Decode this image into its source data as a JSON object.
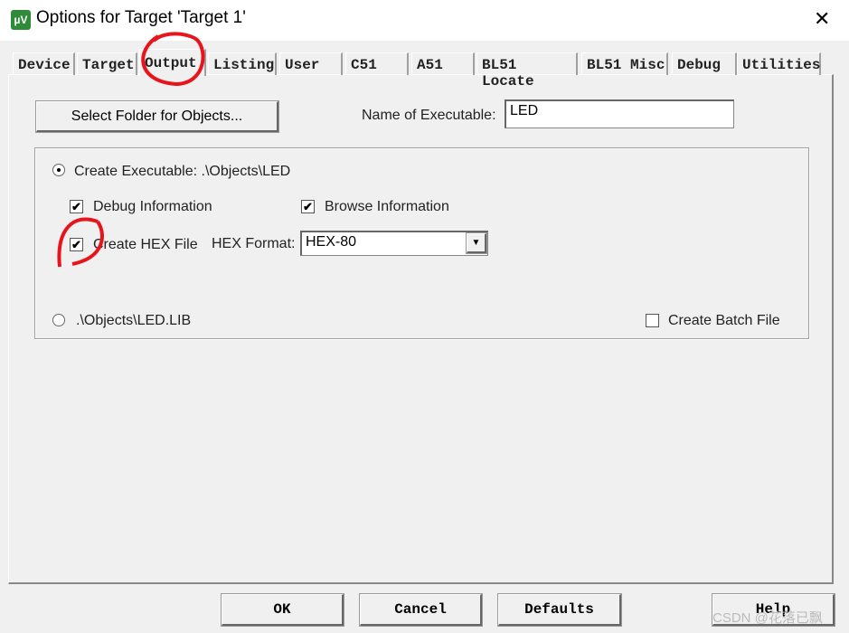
{
  "window": {
    "title": "Options for Target 'Target 1'",
    "icon": "uvision-icon"
  },
  "tabs": [
    {
      "label": "Device"
    },
    {
      "label": "Target"
    },
    {
      "label": "Output",
      "active": true
    },
    {
      "label": "Listing"
    },
    {
      "label": "User"
    },
    {
      "label": "C51"
    },
    {
      "label": "A51"
    },
    {
      "label": "BL51 Locate"
    },
    {
      "label": "BL51 Misc"
    },
    {
      "label": "Debug"
    },
    {
      "label": "Utilities"
    }
  ],
  "output": {
    "select_folder_label": "Select Folder for Objects...",
    "name_label": "Name of Executable:",
    "name_value": "LED",
    "create_exe_label": "Create Executable:  .\\Objects\\LED",
    "create_exe_selected": true,
    "debug_info_label": "Debug Information",
    "debug_info_checked": true,
    "browse_info_label": "Browse Information",
    "browse_info_checked": true,
    "hex_file_label": "Create HEX File",
    "hex_file_checked": true,
    "hex_format_label": "HEX Format:",
    "hex_format_value": "HEX-80",
    "lib_label": ".\\Objects\\LED.LIB",
    "lib_selected": false,
    "batch_label": "Create Batch File",
    "batch_checked": false
  },
  "buttons": {
    "ok": "OK",
    "cancel": "Cancel",
    "defaults": "Defaults",
    "help": "Help"
  },
  "watermark": "CSDN @花落已飘",
  "annotation_color": "#e8141b"
}
